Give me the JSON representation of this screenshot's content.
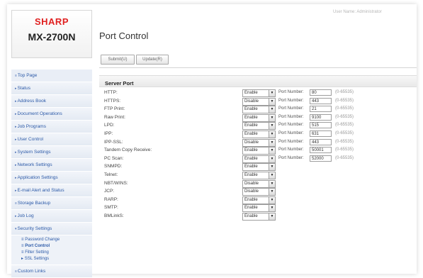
{
  "header": {
    "brand": "SHARP",
    "model": "MX-2700N",
    "user_name": "User Name: Administrator",
    "title": "Port Control"
  },
  "toolbar": {
    "submit_label": "Submit(U)",
    "update_label": "Update(R)"
  },
  "sidebar": {
    "items": [
      {
        "label": "Top Page",
        "marker": "≡"
      },
      {
        "label": "Status",
        "marker": "▸"
      },
      {
        "label": "Address Book",
        "marker": "▸"
      },
      {
        "label": "Document Operations",
        "marker": "▸"
      },
      {
        "label": "Job Programs",
        "marker": "▸"
      },
      {
        "label": "User Control",
        "marker": "▸"
      },
      {
        "label": "System Settings",
        "marker": "▸"
      },
      {
        "label": "Network Settings",
        "marker": "▸"
      },
      {
        "label": "Application Settings",
        "marker": "▸"
      },
      {
        "label": "E-mail Alert and Status",
        "marker": "▸"
      },
      {
        "label": "Storage Backup",
        "marker": "≡"
      },
      {
        "label": "Job Log",
        "marker": "▸"
      },
      {
        "label": "Security Settings",
        "marker": "▾"
      }
    ],
    "security_subitems": [
      {
        "label": "Password Change",
        "marker": "≡"
      },
      {
        "label": "Port Control",
        "marker": "≡"
      },
      {
        "label": "Filter Setting",
        "marker": "≡"
      },
      {
        "label": "SSL Settings",
        "marker": "▸"
      }
    ],
    "last_item": {
      "label": "Custom Links",
      "marker": "≡"
    }
  },
  "section": {
    "title": "Server Port"
  },
  "port_number_label": "Port Number:",
  "range_text": "(0-65535)",
  "ports": [
    {
      "name": "HTTP:",
      "state": "Enable",
      "port": "80"
    },
    {
      "name": "HTTPS:",
      "state": "Disable",
      "port": "443"
    },
    {
      "name": "FTP Print:",
      "state": "Enable",
      "port": "21"
    },
    {
      "name": "Raw Print:",
      "state": "Enable",
      "port": "9100"
    },
    {
      "name": "LPD:",
      "state": "Enable",
      "port": "515"
    },
    {
      "name": "IPP:",
      "state": "Enable",
      "port": "631"
    },
    {
      "name": "IPP-SSL:",
      "state": "Disable",
      "port": "443"
    },
    {
      "name": "Tandem Copy Receive:",
      "state": "Enable",
      "port": "50001"
    },
    {
      "name": "PC Scan:",
      "state": "Enable",
      "port": "52000"
    },
    {
      "name": "SNMPD:",
      "state": "Enable",
      "port": null
    },
    {
      "name": "Telnet:",
      "state": "Enable",
      "port": null
    },
    {
      "name": "NBT/WINS:",
      "state": "Disable",
      "port": null
    },
    {
      "name": "JCP:",
      "state": "Disable",
      "port": null
    },
    {
      "name": "RARP:",
      "state": "Enable",
      "port": null
    },
    {
      "name": "SMTP:",
      "state": "Enable",
      "port": null
    },
    {
      "name": "BMLinkS:",
      "state": "Enable",
      "port": null
    }
  ],
  "icons": {
    "dropdown": "chevron-down-icon",
    "nav": "arrow-right-icon"
  },
  "colors": {
    "brand": "#e02020",
    "nav_text": "#2c5aa8"
  }
}
